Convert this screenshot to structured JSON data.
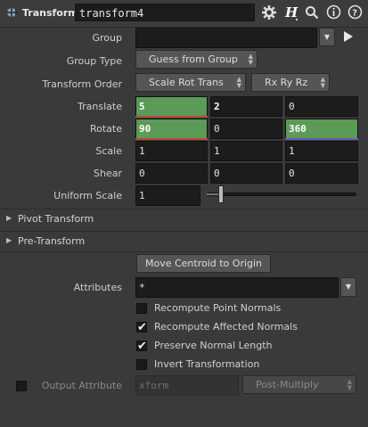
{
  "header": {
    "node_type": "Transform",
    "node_name": "transform4",
    "icons": [
      "gear-icon",
      "help-hash-icon",
      "search-icon",
      "info-icon",
      "question-icon"
    ]
  },
  "params": {
    "group_label": "Group",
    "group_value": "",
    "group_type_label": "Group Type",
    "group_type_value": "Guess from Group",
    "transform_order_label": "Transform Order",
    "transform_order_value": "Scale Rot Trans",
    "rotate_order_value": "Rx Ry Rz",
    "translate_label": "Translate",
    "translate": [
      "5",
      "2",
      "0"
    ],
    "rotate_label": "Rotate",
    "rotate": [
      "90",
      "0",
      "360"
    ],
    "scale_label": "Scale",
    "scale": [
      "1",
      "1",
      "1"
    ],
    "shear_label": "Shear",
    "shear": [
      "0",
      "0",
      "0"
    ],
    "uniform_scale_label": "Uniform Scale",
    "uniform_scale_value": "1",
    "uniform_scale_slider": 0.1
  },
  "sections": {
    "pivot": "Pivot Transform",
    "pre": "Pre-Transform"
  },
  "attrs": {
    "move_centroid": "Move Centroid to Origin",
    "attributes_label": "Attributes",
    "attributes_value": "*",
    "recompute_point_normals": "Recompute Point Normals",
    "recompute_affected_normals": "Recompute Affected Normals",
    "preserve_normal_length": "Preserve Normal Length",
    "invert_transformation": "Invert Transformation",
    "output_attribute_label": "Output Attribute",
    "output_attribute_placeholder": "xform",
    "output_mode": "Post-Multiply"
  },
  "colors": {
    "highlight": "#5c9a57",
    "x_axis": "#b84a3a",
    "z_axis": "#6a5ab8"
  }
}
